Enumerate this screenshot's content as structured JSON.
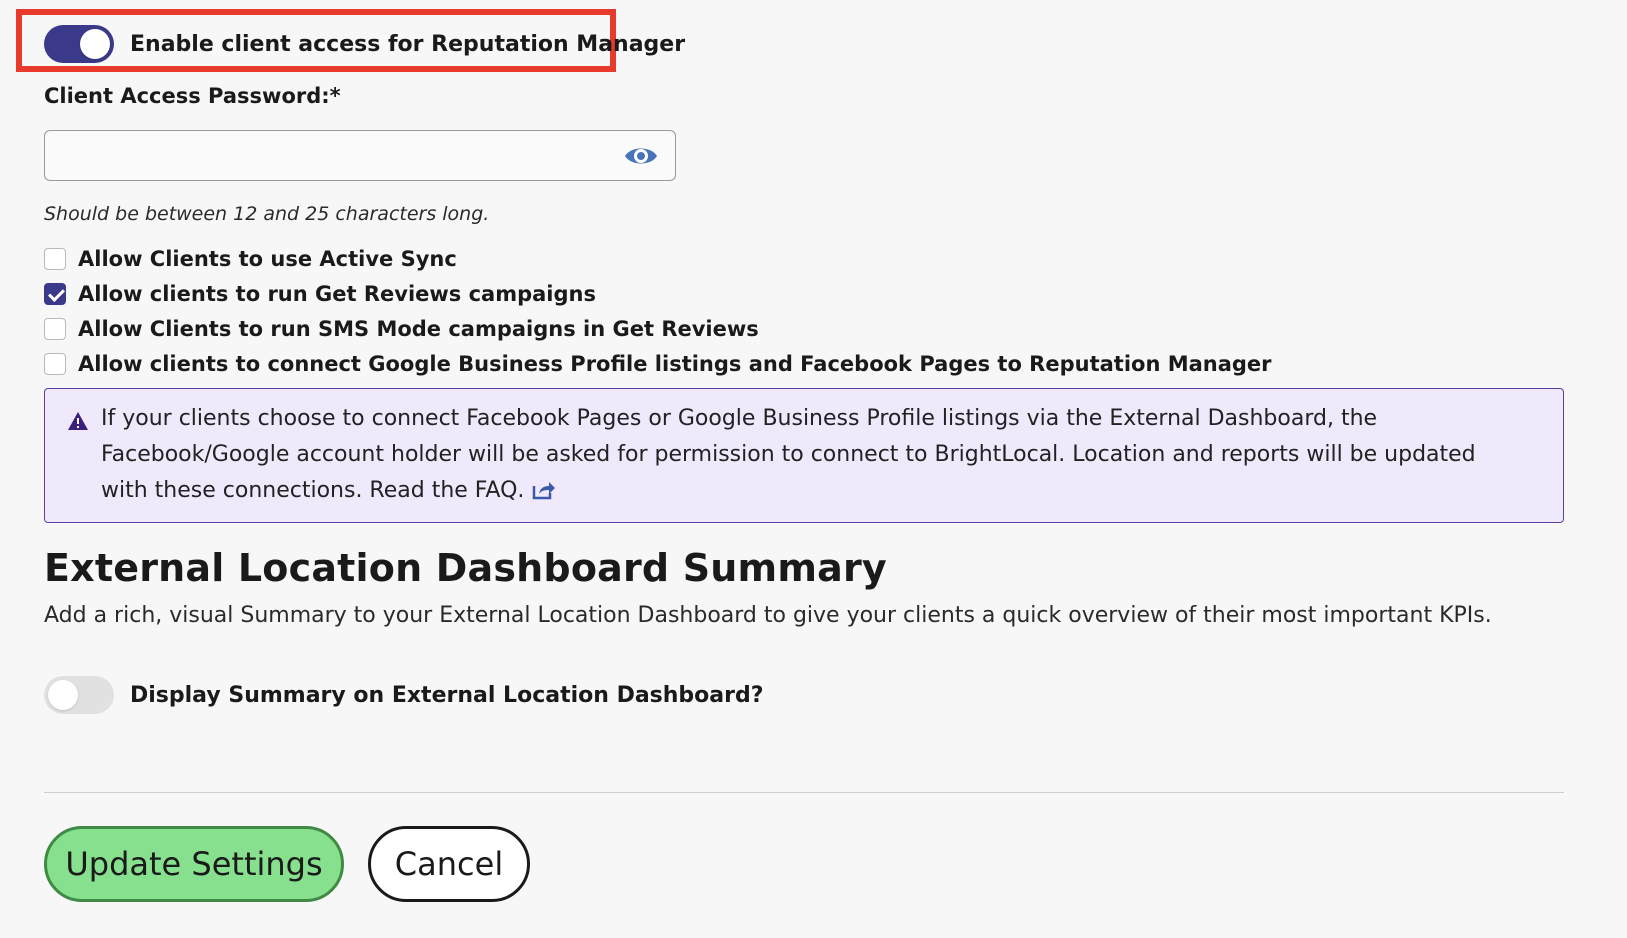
{
  "client_access": {
    "toggle_label": "Enable client access for Reputation Manager",
    "toggle_on": true
  },
  "password": {
    "label": "Client Access Password:*",
    "value": "",
    "placeholder": "",
    "hint": "Should be between 12 and 25 characters long.",
    "icon": "eye-icon"
  },
  "options": [
    {
      "label": "Allow Clients to use Active Sync",
      "checked": false
    },
    {
      "label": "Allow clients to run Get Reviews campaigns",
      "checked": true
    },
    {
      "label": "Allow Clients to run SMS Mode campaigns in Get Reviews",
      "checked": false
    },
    {
      "label": "Allow clients to connect Google Business Profile listings and Facebook Pages to Reputation Manager",
      "checked": false
    }
  ],
  "alert": {
    "text": "If your clients choose to connect Facebook Pages or Google Business Profile listings via the External Dashboard, the Facebook/Google account holder will be asked for permission to connect to BrightLocal. Location and reports will be updated with these connections. Read the FAQ.",
    "icon": "warning-icon",
    "link_icon": "external-link-icon"
  },
  "summary": {
    "title": "External Location Dashboard Summary",
    "description": "Add a rich, visual Summary to your External Location Dashboard to give your clients a quick overview of their most important KPIs.",
    "toggle_label": "Display Summary on External Location Dashboard?",
    "toggle_on": false
  },
  "actions": {
    "update_label": "Update Settings",
    "cancel_label": "Cancel"
  },
  "colors": {
    "accent": "#3b3a8a",
    "highlight": "#e83a2c",
    "primary_button": "#86e08d",
    "alert_bg": "#efe9fb"
  }
}
